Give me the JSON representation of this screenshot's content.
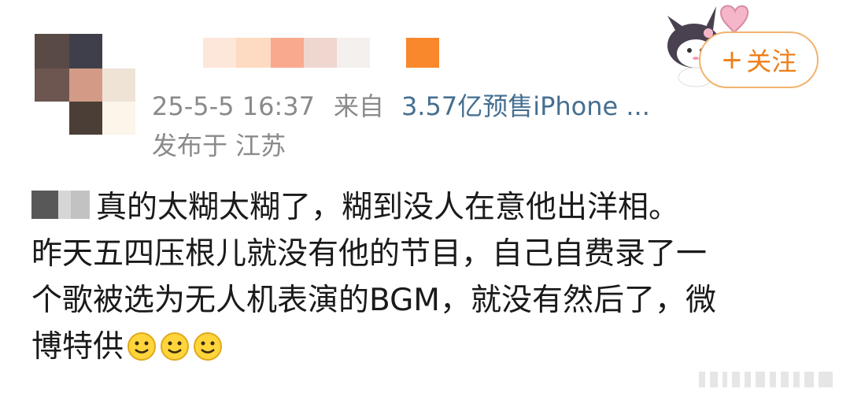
{
  "post": {
    "timestamp": "25-5-5 16:37",
    "from_label": "来自",
    "source_device": "3.57亿预售iPhone ...",
    "location": "发布于 江苏",
    "follow_label": "关注",
    "follow_plus": "+",
    "text_line1": "真的太糊太糊了，糊到没人在意他出洋相。",
    "text_line2": "昨天五四压根儿就没有他的节目，自己自费录了一",
    "text_line3": "个歌被选为无人机表演的BGM，就没有然后了，微",
    "text_line4": "博特供"
  },
  "icons": {
    "avatar": "pixelated-avatar",
    "name": "pixelated-username",
    "mascot": "kuromi-sticker-icon",
    "emoji": "smile-emoji-icon",
    "watermark": "weibo-watermark"
  },
  "colors": {
    "accent": "#ef7f1a",
    "meta": "#8a8a8a",
    "source": "#466f91",
    "text": "#1a1a1a"
  }
}
